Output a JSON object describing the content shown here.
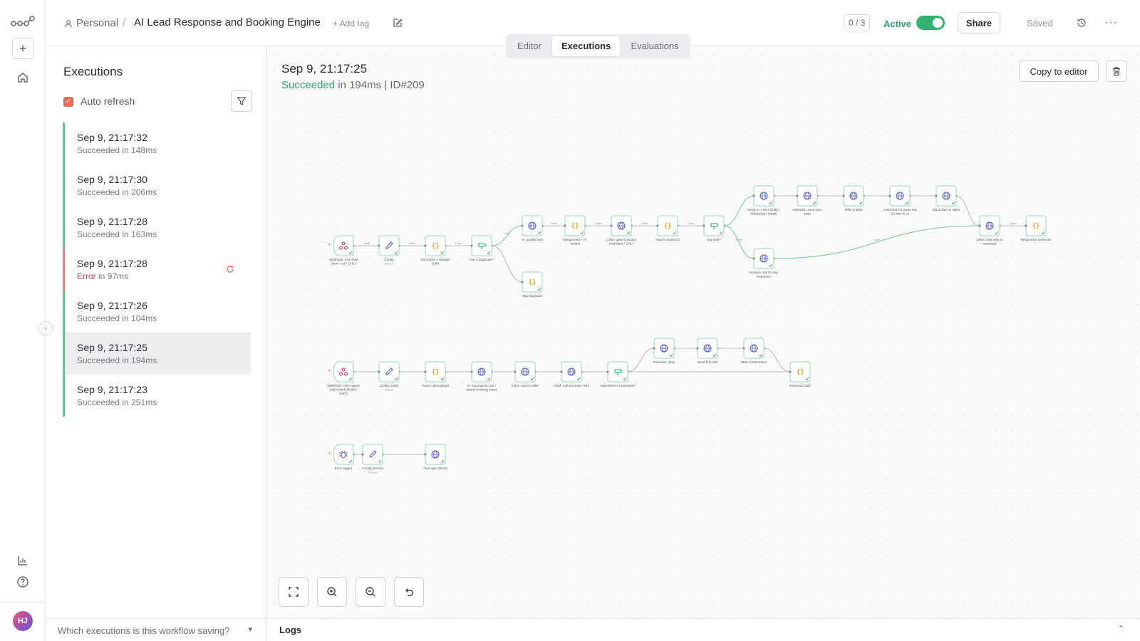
{
  "header": {
    "workspace": "Personal",
    "workflow_name": "AI Lead Response and Booking Engine",
    "add_tag": "+ Add tag",
    "count": "0 / 3",
    "active_label": "Active",
    "share_label": "Share",
    "saved_label": "Saved",
    "active": true
  },
  "tabs": [
    {
      "label": "Editor",
      "selected": false
    },
    {
      "label": "Executions",
      "selected": true
    },
    {
      "label": "Evaluations",
      "selected": false
    }
  ],
  "sidebar": {
    "title": "Executions",
    "auto_refresh_label": "Auto refresh",
    "auto_refresh": true,
    "footer_question": "Which executions is this workflow saving?",
    "executions": [
      {
        "date": "Sep 9, 21:17:32",
        "status": "Succeeded",
        "duration": "in 148ms",
        "selected": false
      },
      {
        "date": "Sep 9, 21:17:30",
        "status": "Succeeded",
        "duration": "in 206ms",
        "selected": false
      },
      {
        "date": "Sep 9, 21:17:28",
        "status": "Succeeded",
        "duration": "in 163ms",
        "selected": false
      },
      {
        "date": "Sep 9, 21:17:28",
        "status": "Error",
        "duration": "in 97ms",
        "selected": false
      },
      {
        "date": "Sep 9, 21:17:26",
        "status": "Succeeded",
        "duration": "in 104ms",
        "selected": false
      },
      {
        "date": "Sep 9, 21:17:25",
        "status": "Succeeded",
        "duration": "in 194ms",
        "selected": true
      },
      {
        "date": "Sep 9, 21:17:23",
        "status": "Succeeded",
        "duration": "in 251ms",
        "selected": false
      }
    ]
  },
  "detail": {
    "date": "Sep 9, 21:17:25",
    "status": "Succeeded",
    "duration": "in 194ms",
    "separator": "|",
    "id": "ID#209",
    "copy_label": "Copy to editor"
  },
  "logs_label": "Logs",
  "user_initials": "HJ",
  "colors": {
    "success": "#2fa36b",
    "error": "#d83c3c",
    "accent": "#ec6a52",
    "code_node": "#e8a317",
    "http_node": "#4a55c7",
    "if_node": "#2fa36b",
    "trigger_node": "#c9304a"
  },
  "workflow_nodes": [
    {
      "id": "n1",
      "label": "Webhook: new lead (form / ad / CHL)",
      "icon": "webhook-icon"
    },
    {
      "id": "n2",
      "label": "Config",
      "sublabel": "Manual",
      "icon": "pencil-icon"
    },
    {
      "id": "n3",
      "label": "Normalize + dedupe (24h)",
      "icon": "code-icon"
    },
    {
      "id": "n4",
      "label": "Not a duplicate?",
      "icon": "if-icon"
    },
    {
      "id": "n5",
      "label": "AI: qualify lead",
      "icon": "globe-icon"
    },
    {
      "id": "n6",
      "label": "Skip duplicate",
      "icon": "code-icon"
    },
    {
      "id": "n7",
      "label": "Merge lead + AI verdict",
      "icon": "code-icon"
    },
    {
      "id": "n8",
      "label": "CRM: upsert contact (HubSpot / GHL)",
      "icon": "globe-icon"
    },
    {
      "id": "n9",
      "label": "Attach contact id",
      "icon": "code-icon"
    },
    {
      "id": "n10",
      "label": "Hot lead?",
      "icon": "if-icon"
    },
    {
      "id": "n11",
      "label": "Reply in < 60 s (SMS / WhatsApp / email)",
      "icon": "globe-icon"
    },
    {
      "id": "n12",
      "label": "Calendar: next open slots",
      "icon": "globe-icon"
    },
    {
      "id": "n13",
      "label": "Offer 3 slots",
      "icon": "globe-icon"
    },
    {
      "id": "n14",
      "label": "CRM task for sales rep (15 min SLA)",
      "icon": "globe-icon"
    },
    {
      "id": "n15",
      "label": "Slack alert to sales",
      "icon": "globe-icon"
    },
    {
      "id": "n16",
      "label": "Nurture: start 5-day sequence",
      "icon": "globe-icon"
    },
    {
      "id": "n17",
      "label": "CRM: note with AI summary",
      "icon": "globe-icon"
    },
    {
      "id": "n18",
      "label": "Respond to webhook",
      "icon": "code-icon"
    },
    {
      "id": "n19",
      "label": "Webhook: voice agent call ended (Retell / VAPI)",
      "icon": "webhook-icon"
    },
    {
      "id": "n20",
      "label": "Config (calls)",
      "sublabel": "Manual",
      "icon": "pencil-icon"
    },
    {
      "id": "n21",
      "label": "Parse call payload",
      "icon": "code-icon"
    },
    {
      "id": "n22",
      "label": "AI: summarize call + detect booking intent",
      "icon": "globe-icon"
    },
    {
      "id": "n23",
      "label": "CRM: upsert caller",
      "icon": "globe-icon"
    },
    {
      "id": "n24",
      "label": "CRM: call summary note",
      "icon": "globe-icon"
    },
    {
      "id": "n25",
      "label": "Appointment requested?",
      "icon": "if-icon"
    },
    {
      "id": "n26",
      "label": "Calendar: slots",
      "icon": "globe-icon"
    },
    {
      "id": "n27",
      "label": "Book first slot",
      "icon": "globe-icon"
    },
    {
      "id": "n28",
      "label": "SMS confirmation",
      "icon": "globe-icon"
    },
    {
      "id": "n29",
      "label": "Respond (call)",
      "icon": "code-icon"
    },
    {
      "id": "n30",
      "label": "Error trigger",
      "icon": "bug-icon"
    },
    {
      "id": "n31",
      "label": "Config (errors)",
      "sublabel": "Manual",
      "icon": "pencil-icon"
    },
    {
      "id": "n32",
      "label": "Alert ops (Slack)",
      "icon": "globe-icon"
    }
  ],
  "edge_labels": {
    "one_item": "1 item",
    "true": "true",
    "false": "false"
  }
}
